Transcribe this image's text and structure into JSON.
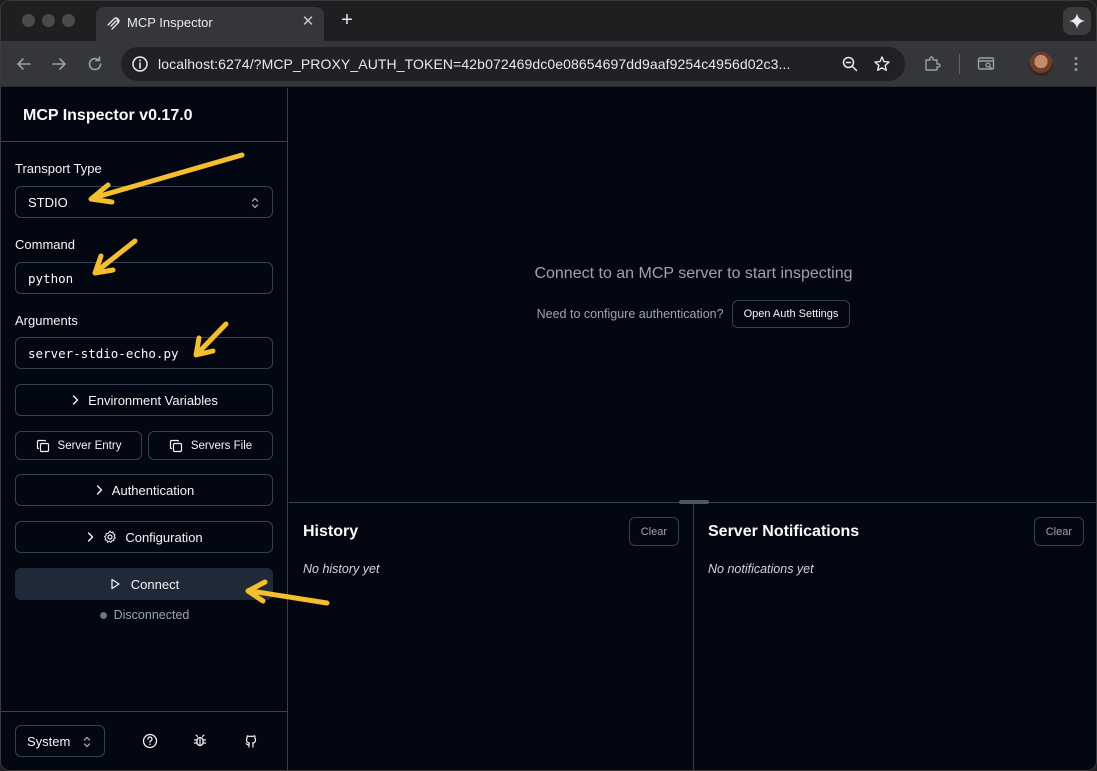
{
  "browser": {
    "tab_title": "MCP Inspector",
    "new_tab": "+",
    "url": "localhost:6274/?MCP_PROXY_AUTH_TOKEN=42b072469dc0e08654697dd9aaf9254c4956d02c3..."
  },
  "sidebar": {
    "app_title": "MCP Inspector v0.17.0",
    "transport_label": "Transport Type",
    "transport_value": "STDIO",
    "command_label": "Command",
    "command_value": "python",
    "arguments_label": "Arguments",
    "arguments_value": "server-stdio-echo.py",
    "env_vars_label": "Environment Variables",
    "server_entry_label": "Server Entry",
    "servers_file_label": "Servers File",
    "authentication_label": "Authentication",
    "configuration_label": "Configuration",
    "connect_label": "Connect",
    "status_text": "Disconnected",
    "theme_value": "System"
  },
  "main": {
    "empty_title": "Connect to an MCP server to start inspecting",
    "auth_question": "Need to configure authentication?",
    "auth_button": "Open Auth Settings",
    "history": {
      "title": "History",
      "clear": "Clear",
      "empty": "No history yet"
    },
    "notifications": {
      "title": "Server Notifications",
      "clear": "Clear",
      "empty": "No notifications yet"
    }
  },
  "colors": {
    "background": "#030712",
    "border": "#374151",
    "annotation_arrow": "#f4bf2a",
    "muted_text": "#9ca3af"
  }
}
